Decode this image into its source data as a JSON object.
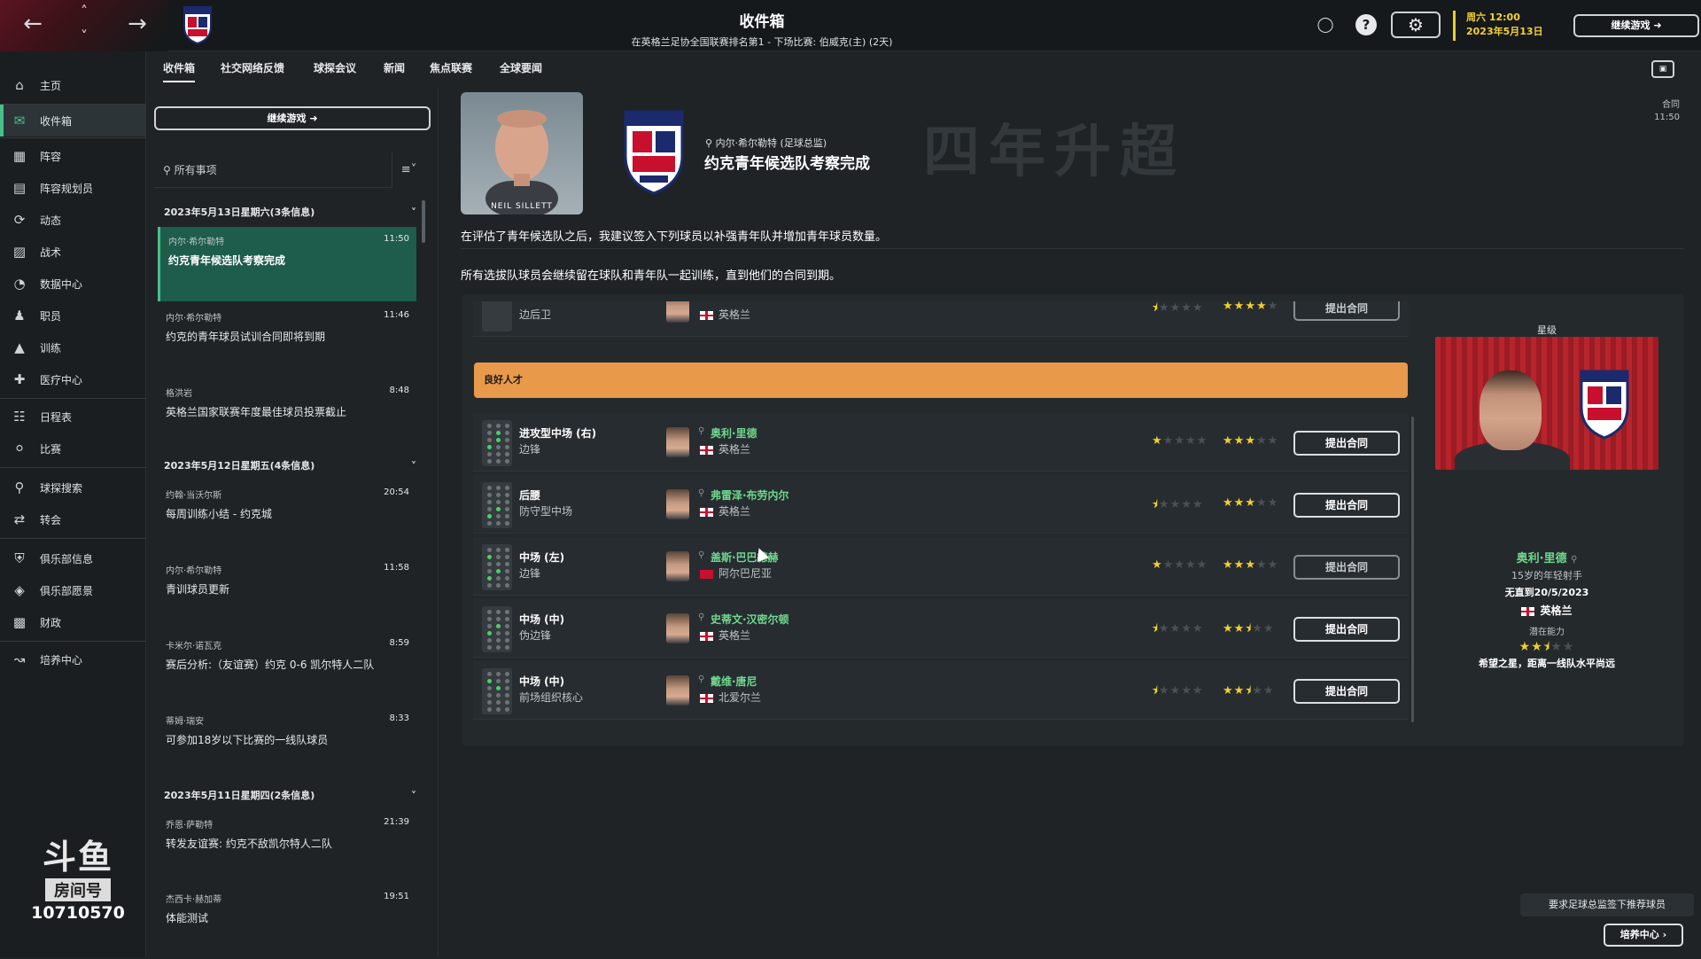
{
  "header": {
    "title": "收件箱",
    "subtitle": "在英格兰足协全国联赛排名第1 - 下场比赛: 伯威克(主) (2天)",
    "day_time": "周六 12:00",
    "date": "2023年5月13日",
    "continue_label": "继续游戏"
  },
  "sidebar": {
    "items": [
      {
        "label": "主页",
        "icon": "home-icon"
      },
      {
        "label": "收件箱",
        "icon": "inbox-icon"
      },
      {
        "label": "阵容",
        "icon": "shirt-icon"
      },
      {
        "label": "阵容规划员",
        "icon": "clipboard-icon"
      },
      {
        "label": "动态",
        "icon": "dynamics-icon"
      },
      {
        "label": "战术",
        "icon": "tactics-icon"
      },
      {
        "label": "数据中心",
        "icon": "data-icon"
      },
      {
        "label": "职员",
        "icon": "staff-icon"
      },
      {
        "label": "训练",
        "icon": "training-icon"
      },
      {
        "label": "医疗中心",
        "icon": "medical-icon"
      },
      {
        "label": "日程表",
        "icon": "calendar-icon"
      },
      {
        "label": "比赛",
        "icon": "trophy-icon"
      },
      {
        "label": "球探搜索",
        "icon": "search-icon"
      },
      {
        "label": "转会",
        "icon": "transfer-icon"
      },
      {
        "label": "俱乐部信息",
        "icon": "shield-icon"
      },
      {
        "label": "俱乐部愿景",
        "icon": "vision-icon"
      },
      {
        "label": "财政",
        "icon": "finance-icon"
      },
      {
        "label": "培养中心",
        "icon": "development-icon"
      }
    ]
  },
  "watermark": {
    "logo": "斗鱼",
    "room_label": "房间号",
    "room_number": "10710570"
  },
  "tabs": [
    "收件箱",
    "社交网络反馈",
    "球探会议",
    "新闻",
    "焦点联赛",
    "全球要闻"
  ],
  "inbox": {
    "continue_label": "继续游戏",
    "search_placeholder": "所有事项",
    "days": [
      {
        "header": "2023年5月13日星期六(3条信息)"
      },
      {
        "header": "2023年5月12日星期五(4条信息)"
      },
      {
        "header": "2023年5月11日星期四(2条信息)"
      }
    ],
    "messages": [
      {
        "sender": "内尔·希尔勒特",
        "time": "11:50",
        "subject": "约克青年候选队考察完成"
      },
      {
        "sender": "内尔·希尔勒特",
        "time": "11:46",
        "subject": "约克的青年球员试训合同即将到期"
      },
      {
        "sender": "格洪岩",
        "time": "8:48",
        "subject": "英格兰国家联赛年度最佳球员投票截止"
      },
      {
        "sender": "约翰·当沃尔斯",
        "time": "20:54",
        "subject": "每周训练小结 - 约克城"
      },
      {
        "sender": "内尔·希尔勒特",
        "time": "11:58",
        "subject": "青训球员更新"
      },
      {
        "sender": "卡米尔·诺瓦克",
        "time": "8:59",
        "subject": "赛后分析:（友谊赛）约克 0-6 凯尔特人二队"
      },
      {
        "sender": "蒂姆·瑞安",
        "time": "8:33",
        "subject": "可参加18岁以下比赛的一线队球员"
      },
      {
        "sender": "乔恩·萨勒特",
        "time": "21:39",
        "subject": "转发友谊赛: 约克不敌凯尔特人二队"
      },
      {
        "sender": "杰西卡·赫加蒂",
        "time": "19:51",
        "subject": "体能测试"
      }
    ]
  },
  "message": {
    "portrait_caption": "NEIL SILLETT",
    "sender_line": "内尔·希尔勒特 (足球总监)",
    "title": "约克青年候选队考察完成",
    "banner_text": "四年升超",
    "contract_tag": "合同",
    "time": "11:50",
    "paragraph1": "在评估了青年候选队之后，我建议签入下列球员以补强青年队并增加青年球员数量。",
    "paragraph2": "所有选拔队球员会继续留在球队和青年队一起训练，直到他们的合同到期。"
  },
  "players_partial": {
    "role": "边后卫",
    "nation": "英格兰",
    "ca_stars": 0.5,
    "pa_stars": 4,
    "offer_label": "提出合同"
  },
  "section_label": "良好人才",
  "players": [
    {
      "position": "进攻型中场 (右)",
      "role": "边锋",
      "name": "奥利·里德",
      "nation": "英格兰",
      "ca_stars": 1,
      "pa_stars": 3,
      "offer_label": "提出合同"
    },
    {
      "position": "后腰",
      "role": "防守型中场",
      "name": "弗雷泽·布劳内尔",
      "nation": "英格兰",
      "ca_stars": 0.5,
      "pa_stars": 3,
      "offer_label": "提出合同"
    },
    {
      "position": "中场 (左)",
      "role": "边锋",
      "name": "盖斯·巴巴德赫",
      "nation": "阿尔巴尼亚",
      "ca_stars": 1,
      "pa_stars": 3,
      "offer_label": "提出合同"
    },
    {
      "position": "中场 (中)",
      "role": "伪边锋",
      "name": "史蒂文·汉密尔顿",
      "nation": "英格兰",
      "ca_stars": 0.5,
      "pa_stars": 2.5,
      "offer_label": "提出合同"
    },
    {
      "position": "中场 (中)",
      "role": "前场组织核心",
      "name": "戴维·唐尼",
      "nation": "北爱尔兰",
      "ca_stars": 0.5,
      "pa_stars": 2.5,
      "offer_label": "提出合同"
    }
  ],
  "scout_card": {
    "heading": "星级",
    "name": "奥利·里德",
    "description": "15岁的年轻射手",
    "contract": "无直到20/5/2023",
    "nation": "英格兰",
    "potential_label": "潜在能力",
    "potential_stars": 2.5,
    "verdict": "希望之星，距离一线队水平尚远"
  },
  "footer": {
    "recommend_label": "要求足球总监签下推荐球员",
    "development_label": "培养中心"
  },
  "colors": {
    "accent": "#48c08a",
    "section": "#e8994a",
    "star": "#f2cf2f",
    "name": "#6fd88e"
  }
}
